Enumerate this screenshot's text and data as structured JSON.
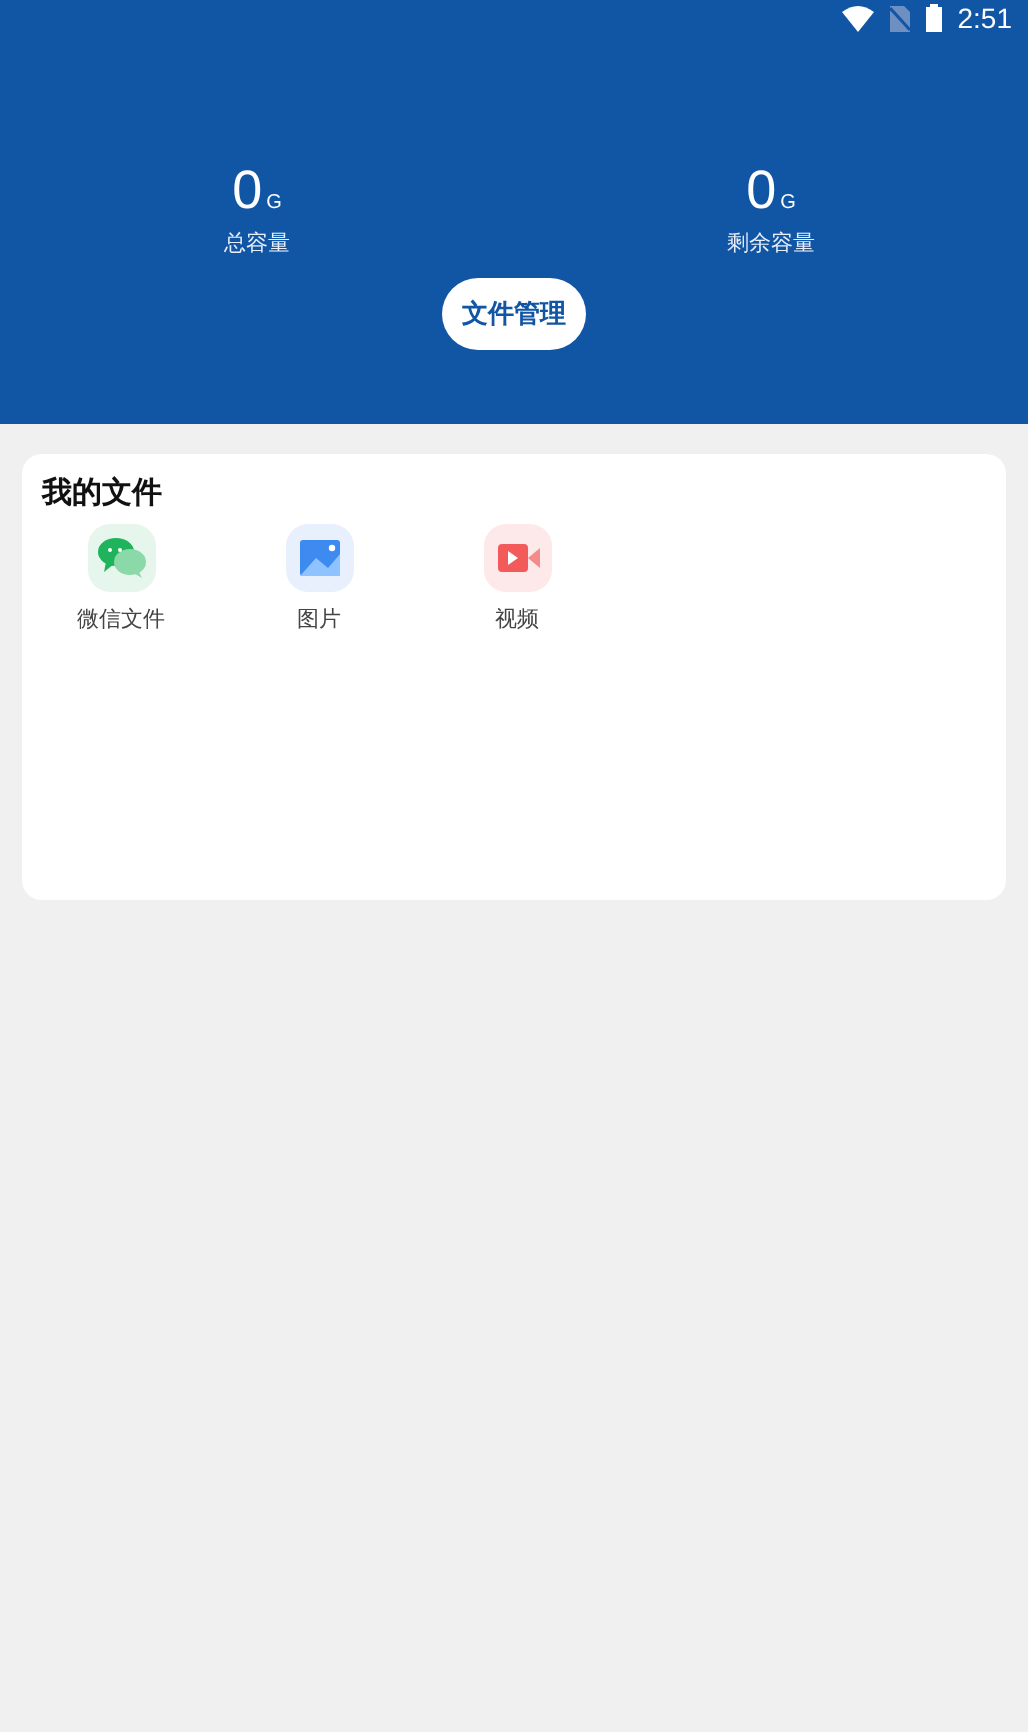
{
  "status_bar": {
    "time": "2:51"
  },
  "storage": [
    {
      "value": "0",
      "unit": "G",
      "label": "总容量"
    },
    {
      "value": "0",
      "unit": "G",
      "label": "剩余容量"
    }
  ],
  "manage_button": "文件管理",
  "my_files": {
    "title": "我的文件",
    "items": [
      {
        "kind": "chat",
        "label": "微信文件"
      },
      {
        "kind": "image",
        "label": "图片"
      },
      {
        "kind": "video",
        "label": "视频"
      }
    ]
  }
}
